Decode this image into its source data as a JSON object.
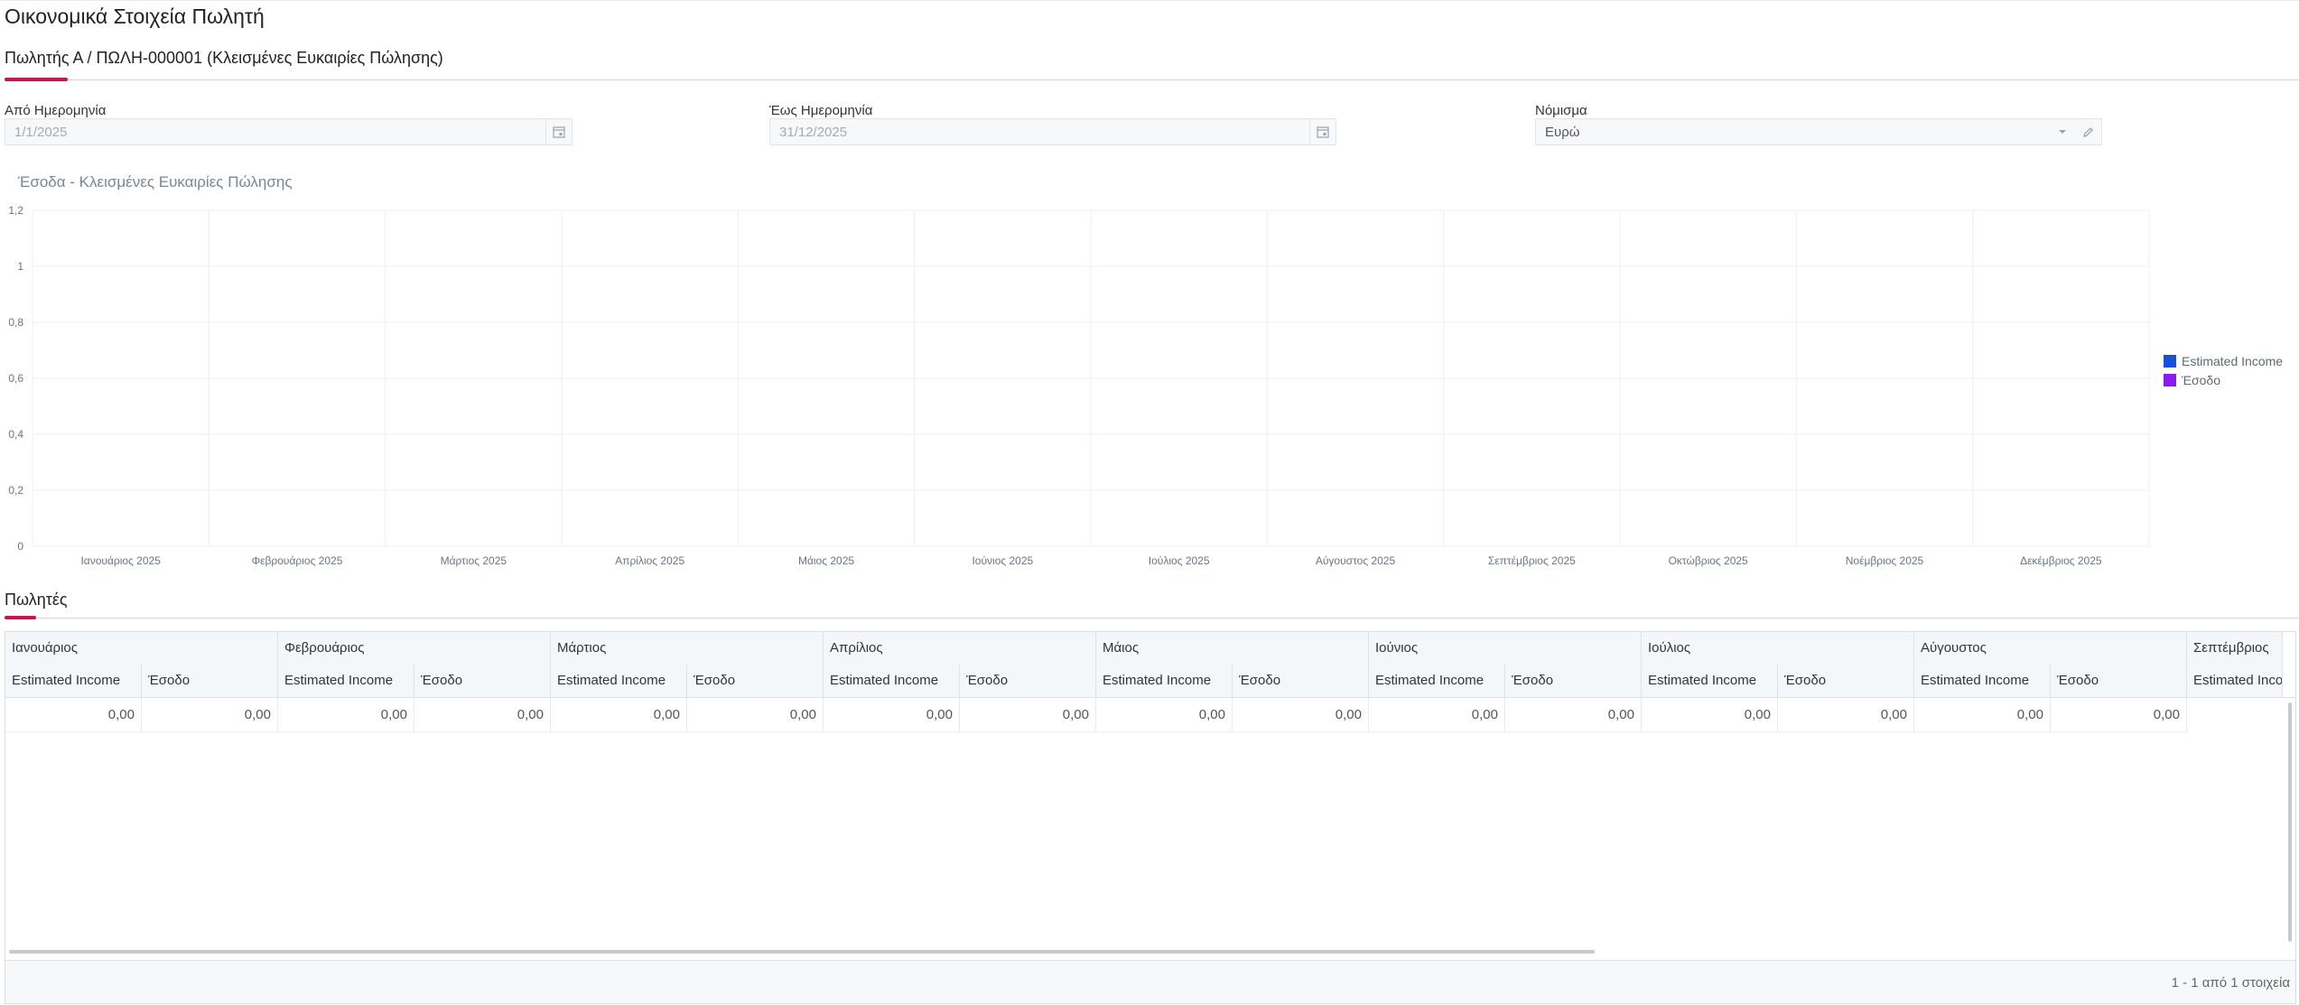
{
  "page": {
    "title": "Οικονομικά Στοιχεία Πωλητή"
  },
  "record_section": {
    "title": "Πωλητής Α / ΠΩΛΗ-000001 (Κλεισμένες Ευκαιρίες Πώλησης)"
  },
  "filters": {
    "from_date": {
      "label": "Από Ημερομηνία",
      "value": "1/1/2025",
      "icon": "calendar-icon"
    },
    "to_date": {
      "label": "Έως Ημερομηνία",
      "value": "31/12/2025",
      "icon": "calendar-icon"
    },
    "currency": {
      "label": "Νόμισμα",
      "value": "Ευρώ",
      "icons": [
        "chevron-down-icon",
        "pencil-icon"
      ]
    }
  },
  "colors": {
    "accent": "#c2185b",
    "series_estimated": "#1552d6",
    "series_income": "#8a1bf0"
  },
  "chart_data": {
    "type": "bar",
    "title": "Έσοδα - Κλεισμένες Ευκαιρίες Πώλησης",
    "categories": [
      "Ιανουάριος 2025",
      "Φεβρουάριος 2025",
      "Μάρτιος 2025",
      "Απρίλιος 2025",
      "Μάιος 2025",
      "Ιούνιος 2025",
      "Ιούλιος 2025",
      "Αύγουστος 2025",
      "Σεπτέμβριος 2025",
      "Οκτώβριος 2025",
      "Νοέμβριος 2025",
      "Δεκέμβριος 2025"
    ],
    "series": [
      {
        "name": "Estimated Income",
        "values": [
          0,
          0,
          0,
          0,
          0,
          0,
          0,
          0,
          0,
          0,
          0,
          0
        ],
        "color": "#1552d6"
      },
      {
        "name": "Έσοδο",
        "values": [
          0,
          0,
          0,
          0,
          0,
          0,
          0,
          0,
          0,
          0,
          0,
          0
        ],
        "color": "#8a1bf0"
      }
    ],
    "ylim": [
      0,
      1.2
    ],
    "yticks": [
      "0",
      "0,2",
      "0,4",
      "0,6",
      "0,8",
      "1",
      "1,2"
    ],
    "grid": true,
    "legend": "right"
  },
  "sellers_section": {
    "title": "Πωλητές"
  },
  "table": {
    "months": [
      "Ιανουάριος",
      "Φεβρουάριος",
      "Μάρτιος",
      "Απρίλιος",
      "Μάιος",
      "Ιούνιος",
      "Ιούλιος",
      "Αύγουστος",
      "Σεπτέμβριος"
    ],
    "sub_columns": [
      "Estimated Income",
      "Έσοδο"
    ],
    "rows": [
      [
        "0,00",
        "0,00",
        "0,00",
        "0,00",
        "0,00",
        "0,00",
        "0,00",
        "0,00",
        "0,00",
        "0,00",
        "0,00",
        "0,00",
        "0,00",
        "0,00",
        "0,00",
        "0,00"
      ]
    ],
    "pager_text": "1 - 1 από 1 στοιχεία"
  }
}
